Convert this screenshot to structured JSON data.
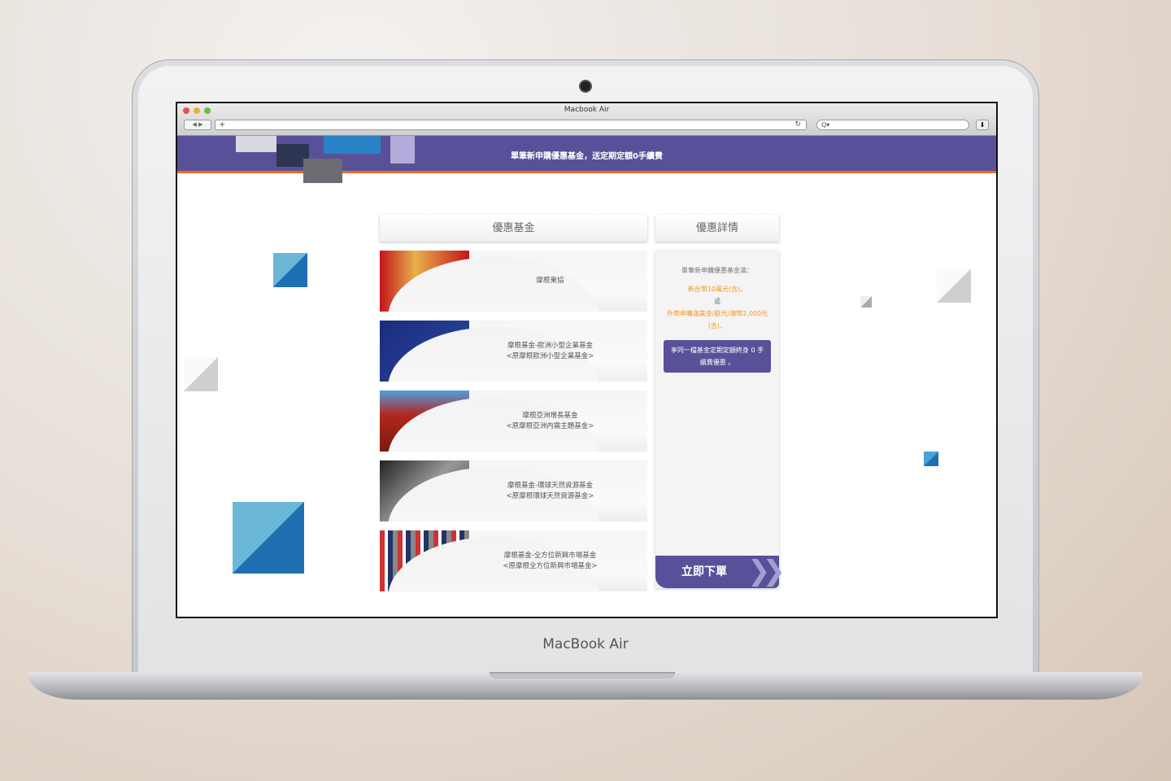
{
  "device": {
    "label": "MacBook Air"
  },
  "browser": {
    "window_title": "Macbook Air",
    "new_tab": "+",
    "reload": "↻",
    "search_icon": "Q▾"
  },
  "banner": {
    "text": "單筆新申購優惠基金，送定期定額0手續費"
  },
  "tabs": {
    "funds": "優惠基金",
    "details": "優惠詳情"
  },
  "funds": [
    {
      "line1": "摩根東協",
      "line2": ""
    },
    {
      "line1": "摩根基金-歐洲小型企業基金",
      "line2": "<原摩根歐洲小型企業基金>"
    },
    {
      "line1": "摩根亞洲增長基金",
      "line2": "<原摩根亞洲內需主題基金>"
    },
    {
      "line1": "摩根基金-環球天然資源基金",
      "line2": "<原摩根環球天然資源基金>"
    },
    {
      "line1": "摩根基金-全方位新興市場基金",
      "line2": "<原摩根全方位新興市場基金>"
    }
  ],
  "details": {
    "intro": "單筆新申購優惠基金滿：",
    "cond1": "新台幣10萬元(含)，",
    "or": "或",
    "cond2": "外幣申購滿美金/歐元/澳幣2,000元(含)，",
    "benefit": "享同一檔基金定期定額終身 0 手續費優惠 。",
    "order_button": "立即下單"
  },
  "colors": {
    "brand": "#58519a",
    "accent": "#f26a1b",
    "highlight": "#f0961f"
  }
}
